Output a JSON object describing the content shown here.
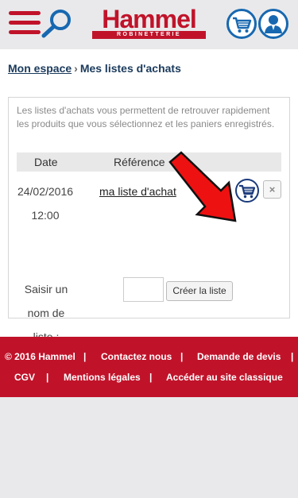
{
  "header": {
    "logo_text": "Hammel",
    "logo_subtext": "ROBINETTERIE",
    "icons": {
      "menu": "hamburger-menu-icon",
      "search": "magnifier-icon",
      "cart": "shopping-cart-icon",
      "account": "user-account-icon"
    }
  },
  "breadcrumb": {
    "home_label": "Mon espace",
    "separator": "›",
    "current_label": "Mes listes d'achats"
  },
  "panel": {
    "intro": "Les listes d'achats vous permettent de retrouver rapidement les produits que vous sélectionnez et les paniers enregistrés.",
    "columns": {
      "date": "Date",
      "reference": "Référence"
    },
    "rows": [
      {
        "date": "24/02/2016 12:00",
        "reference": "ma liste d'achat"
      }
    ],
    "delete_symbol": "×",
    "new_list_label": "Saisir un nom de liste :",
    "new_list_value": "",
    "create_button": "Créer la liste"
  },
  "footer": {
    "copyright": "© 2016 Hammel",
    "separator": "|",
    "contact": "Contactez nous",
    "quote": "Demande de devis",
    "cgv": "CGV",
    "legal": "Mentions légales",
    "classic": "Accéder au site classique"
  },
  "colors": {
    "brand_red": "#c0132a",
    "brand_blue": "#1768b0",
    "navy": "#1a3a5c",
    "background": "#e9e9eb"
  }
}
